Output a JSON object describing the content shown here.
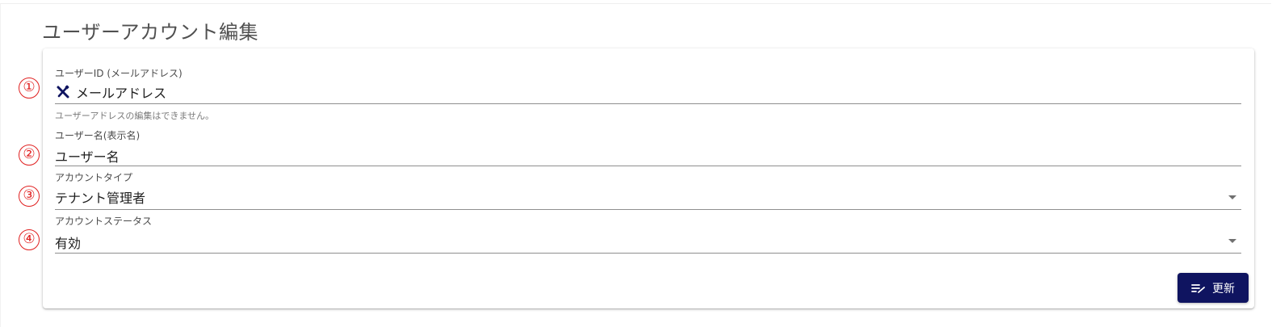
{
  "page": {
    "title": "ユーザーアカウント編集"
  },
  "fields": {
    "user_id": {
      "label": "ユーザーID (メールアドレス)",
      "value": "メールアドレス",
      "icon": "edit-off-icon",
      "hint": "ユーザーアドレスの編集はできません。"
    },
    "user_name": {
      "label": "ユーザー名(表示名)",
      "value": "ユーザー名"
    },
    "account_type": {
      "label": "アカウントタイプ",
      "value": "テナント管理者",
      "icon": "dropdown-arrow-icon"
    },
    "account_status": {
      "label": "アカウントステータス",
      "value": "有効",
      "icon": "dropdown-arrow-icon"
    }
  },
  "markers": [
    "①",
    "②",
    "③",
    "④"
  ],
  "actions": {
    "update_label": "更新",
    "update_icon": "edit-note-icon"
  },
  "colors": {
    "button_bg": "#0f1460",
    "marker": "#e02020",
    "icon": "#0f1460"
  }
}
